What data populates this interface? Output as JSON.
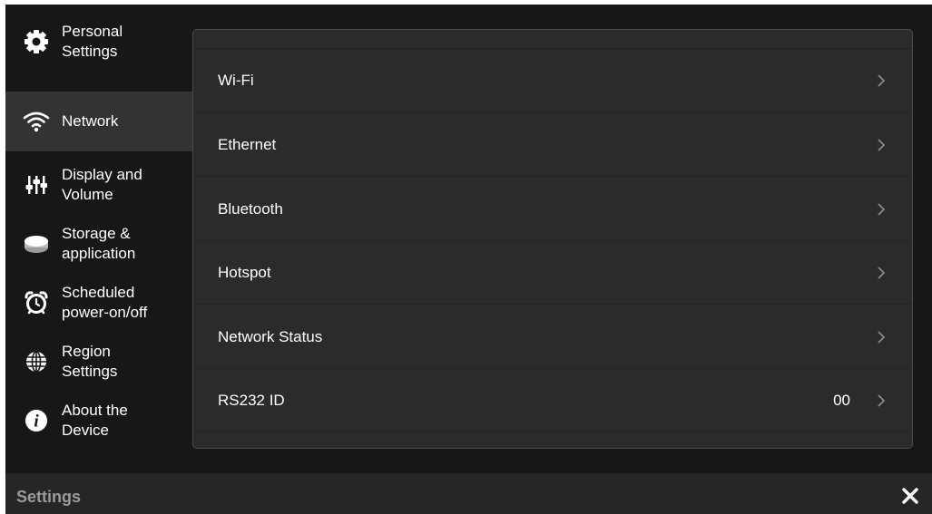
{
  "sidebar": {
    "items": [
      {
        "label": "Personal\nSettings",
        "icon": "gear-icon",
        "active": false
      },
      {
        "label": "Network",
        "icon": "wifi-icon",
        "active": true
      },
      {
        "label": "Display and\nVolume",
        "icon": "sliders-icon",
        "active": false
      },
      {
        "label": "Storage &\napplication",
        "icon": "storage-icon",
        "active": false
      },
      {
        "label": "Scheduled\npower-on/off",
        "icon": "alarm-clock-icon",
        "active": false
      },
      {
        "label": "Region\nSettings",
        "icon": "globe-icon",
        "active": false
      },
      {
        "label": "About the\nDevice",
        "icon": "info-icon",
        "active": false
      }
    ]
  },
  "network": {
    "rows": [
      {
        "label": "Wi-Fi"
      },
      {
        "label": "Ethernet"
      },
      {
        "label": "Bluetooth"
      },
      {
        "label": "Hotspot"
      },
      {
        "label": "Network Status"
      },
      {
        "label": "RS232 ID",
        "value": "00"
      }
    ]
  },
  "bottom_bar": {
    "title": "Settings",
    "close_icon": "close-icon"
  },
  "colors": {
    "background": "#171717",
    "panel": "#2b2b2b",
    "active_item": "#333333",
    "text": "#ffffff",
    "muted_text": "#9a9a9a"
  }
}
